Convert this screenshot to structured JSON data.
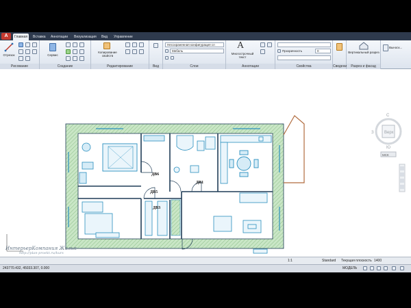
{
  "tabs": [
    {
      "label": "Главная",
      "active": true
    },
    {
      "label": "Вставка",
      "active": false
    },
    {
      "label": "Аннотации",
      "active": false
    },
    {
      "label": "Визуализация",
      "active": false
    },
    {
      "label": "Вид",
      "active": false
    },
    {
      "label": "Управление",
      "active": false
    }
  ],
  "ribbon": {
    "panels": {
      "draw": "Рисование",
      "create": "Создание",
      "modify": "Редактирование",
      "view": "Вид",
      "layers": "Слои",
      "annotation": "Аннотации",
      "properties": "Свойства",
      "groups": "Сведения",
      "section": "Разрез и фасад"
    },
    "tools": {
      "cut": "Отрезок",
      "service": "Сервис",
      "copy_props": "Копирование свойств",
      "layer_config": "Несохраненная конфигурация сл",
      "layer_name": "Мебель",
      "multiline_text": "Многострочный текст",
      "transparency_label": "Прозрачность",
      "transparency_value": "0",
      "vertical_section": "Вертикальный разрез",
      "elevation": "Выноск..."
    }
  },
  "viewcube": {
    "north": "С",
    "south": "Ю",
    "west": "З",
    "top": "Верх",
    "wcs": "МСК"
  },
  "plan_labels": {
    "d1": "ДВ1",
    "d3": "ДВ3",
    "d5": "ДВ5",
    "d6": "ДВ6"
  },
  "watermark": {
    "main": "ИнтерьерКомпания Жилья",
    "sub": "http://plan-proekt.ru/kurs"
  },
  "status": {
    "coords": "243770.432, 45033.307, 0.000",
    "model": "МОДЕЛЬ",
    "scale": "1:1",
    "style": "Standard",
    "plane": "Текущая плоскость",
    "plane_value": "1400"
  },
  "colors": {
    "wall_hatch": "#b7dcb5",
    "wall_line": "#1f3c56",
    "furniture": "#2a8fbf",
    "balcony": "#b06a3c",
    "ribbon_dark": "#2e3a4d"
  }
}
